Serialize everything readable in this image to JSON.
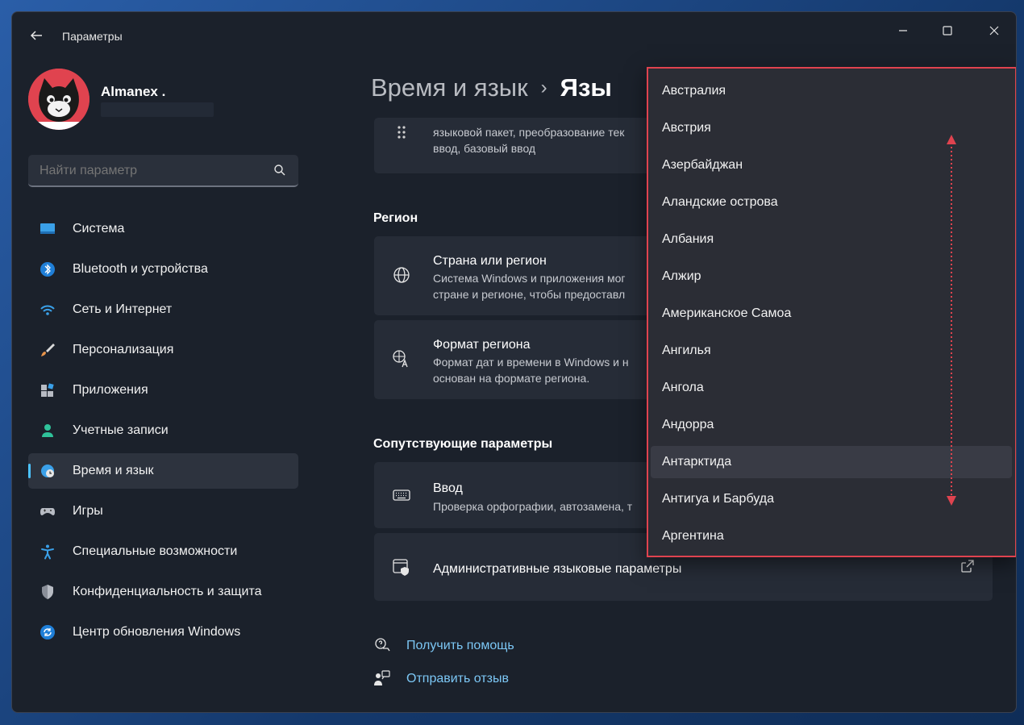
{
  "window": {
    "title": "Параметры"
  },
  "user": {
    "name": "Almanex ."
  },
  "search": {
    "placeholder": "Найти параметр"
  },
  "sidebar": {
    "items": [
      {
        "label": "Система",
        "icon": "display-icon"
      },
      {
        "label": "Bluetooth и устройства",
        "icon": "bluetooth-icon"
      },
      {
        "label": "Сеть и Интернет",
        "icon": "wifi-icon"
      },
      {
        "label": "Персонализация",
        "icon": "brush-icon"
      },
      {
        "label": "Приложения",
        "icon": "apps-icon"
      },
      {
        "label": "Учетные записи",
        "icon": "person-icon"
      },
      {
        "label": "Время и язык",
        "icon": "globe-clock-icon",
        "selected": true
      },
      {
        "label": "Игры",
        "icon": "gamepad-icon"
      },
      {
        "label": "Специальные возможности",
        "icon": "accessibility-icon"
      },
      {
        "label": "Конфиденциальность и защита",
        "icon": "shield-icon"
      },
      {
        "label": "Центр обновления Windows",
        "icon": "update-icon"
      }
    ]
  },
  "breadcrumb": {
    "parent": "Время и язык",
    "separator": "›",
    "current": "Язы"
  },
  "main": {
    "language_card": {
      "desc_line1": "языковой пакет, преобразование тек",
      "desc_line2": "ввод, базовый ввод"
    },
    "region_section": "Регион",
    "country_card": {
      "title": "Страна или регион",
      "desc_line1": "Система Windows и приложения мог",
      "desc_line2": "стране и регионе, чтобы предоставл"
    },
    "format_card": {
      "title": "Формат региона",
      "desc_line1": "Формат дат и времени в Windows и н",
      "desc_line2": "основан на формате региона."
    },
    "related_section": "Сопутствующие параметры",
    "input_card": {
      "title": "Ввод",
      "desc": "Проверка орфографии, автозамена, т"
    },
    "admin_card": {
      "title": "Административные языковые параметры"
    },
    "help": {
      "get_help": "Получить помощь",
      "feedback": "Отправить отзыв"
    }
  },
  "dropdown": {
    "items": [
      "Австралия",
      "Австрия",
      "Азербайджан",
      "Аландские острова",
      "Албания",
      "Алжир",
      "Американское Самоа",
      "Ангилья",
      "Ангола",
      "Андорра",
      "Антарктида",
      "Антигуа и Барбуда",
      "Аргентина"
    ],
    "highlighted": "Антарктида"
  },
  "colors": {
    "accent": "#4cc2ff",
    "annotation": "#e0434f",
    "link": "#7cc7f5"
  }
}
